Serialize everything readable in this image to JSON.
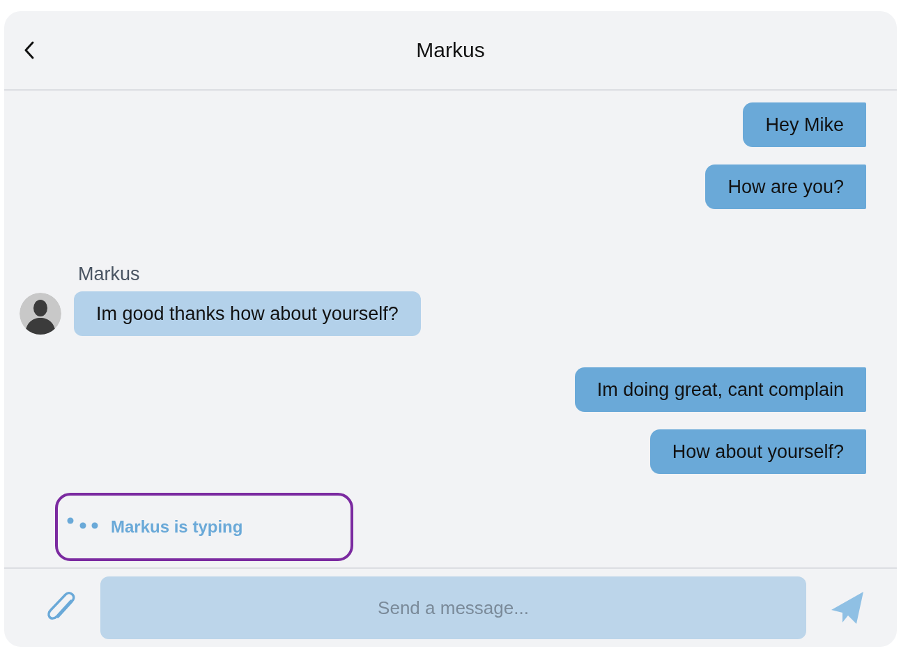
{
  "header": {
    "title": "Markus"
  },
  "messages": [
    {
      "kind": "outgoing",
      "text": "Hey Mike"
    },
    {
      "kind": "outgoing",
      "text": "How are you?"
    },
    {
      "kind": "incoming",
      "sender": "Markus",
      "text": "Im good thanks how about yourself?"
    },
    {
      "kind": "outgoing",
      "text": "Im doing great, cant complain"
    },
    {
      "kind": "outgoing",
      "text": "How about yourself?"
    }
  ],
  "typing": {
    "text": "Markus is typing",
    "highlighted": true
  },
  "composer": {
    "placeholder": "Send a message..."
  }
}
